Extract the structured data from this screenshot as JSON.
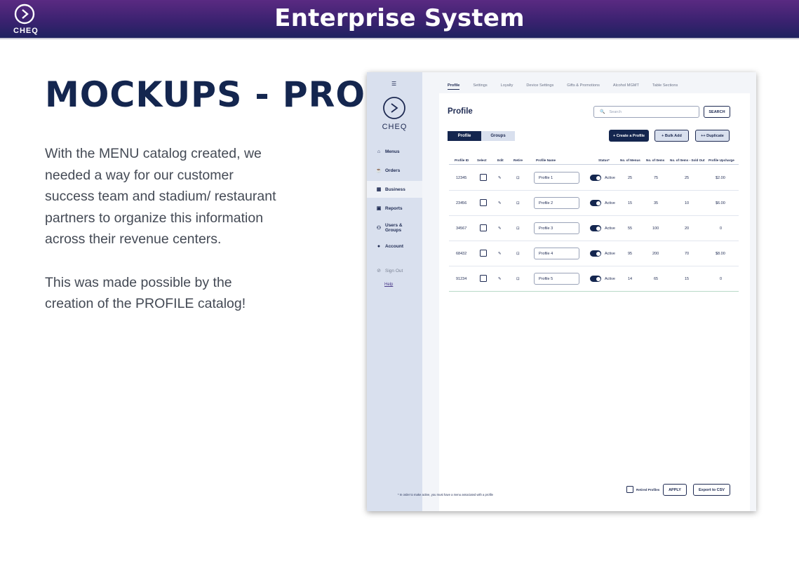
{
  "banner": {
    "title": "Enterprise System",
    "brand": "CHEQ"
  },
  "slide": {
    "title": "MOCKUPS - PROFILE",
    "paragraph1": "With the MENU catalog created, we needed a way for our customer success team and stadium/ restaurant partners to organize this information across their revenue centers.",
    "paragraph2": "This was made possible by the creation of the PROFILE catalog!"
  },
  "mockup": {
    "brand": "CHEQ",
    "nav": [
      {
        "label": "Menus",
        "icon": "menu-bell-icon"
      },
      {
        "label": "Orders",
        "icon": "orders-cup-icon"
      },
      {
        "label": "Business",
        "icon": "business-store-icon"
      },
      {
        "label": "Reports",
        "icon": "reports-chart-icon"
      },
      {
        "label": "Users & Groups",
        "icon": "users-icon"
      },
      {
        "label": "Account",
        "icon": "account-person-icon"
      }
    ],
    "sign_out": "Sign Out",
    "help": "Help",
    "tabs": [
      "Profile",
      "Settings",
      "Loyalty",
      "Device Settings",
      "Gifts & Promotions",
      "Alcohol MGMT",
      "Table Sections"
    ],
    "page_title": "Profile",
    "search_placeholder": "Search",
    "search_button": "SEARCH",
    "segments": [
      "Profile",
      "Groups"
    ],
    "buttons": {
      "create": "+ Create a Profile",
      "bulk_add": "+ Bulk Add",
      "duplicate": "++ Duplicate"
    },
    "columns": [
      "Profile ID",
      "Select",
      "Edit",
      "Retire",
      "Profile Name",
      "Status*",
      "No. of Menus",
      "No. of Items",
      "No. of Items - Sold Out",
      "Profile Upcharge"
    ],
    "rows": [
      {
        "id": "12345",
        "name": "Profile 1",
        "status": "Active",
        "menus": "25",
        "items": "75",
        "sold_out": "25",
        "upcharge": "$2.00"
      },
      {
        "id": "23456",
        "name": "Profile 2",
        "status": "Active",
        "menus": "15",
        "items": "35",
        "sold_out": "10",
        "upcharge": "$6.00"
      },
      {
        "id": "34567",
        "name": "Profile 3",
        "status": "Active",
        "menus": "55",
        "items": "100",
        "sold_out": "20",
        "upcharge": "0"
      },
      {
        "id": "68432",
        "name": "Profile 4",
        "status": "Active",
        "menus": "95",
        "items": "200",
        "sold_out": "70",
        "upcharge": "$8.00"
      },
      {
        "id": "91234",
        "name": "Profile 5",
        "status": "Active",
        "menus": "14",
        "items": "65",
        "sold_out": "15",
        "upcharge": "0"
      }
    ],
    "footnote": "* In order to make active, you must have a menu associated with a profile",
    "retired_label": "Retired Profiles",
    "apply_button": "APPLY",
    "export_button": "Export to CSV"
  }
}
